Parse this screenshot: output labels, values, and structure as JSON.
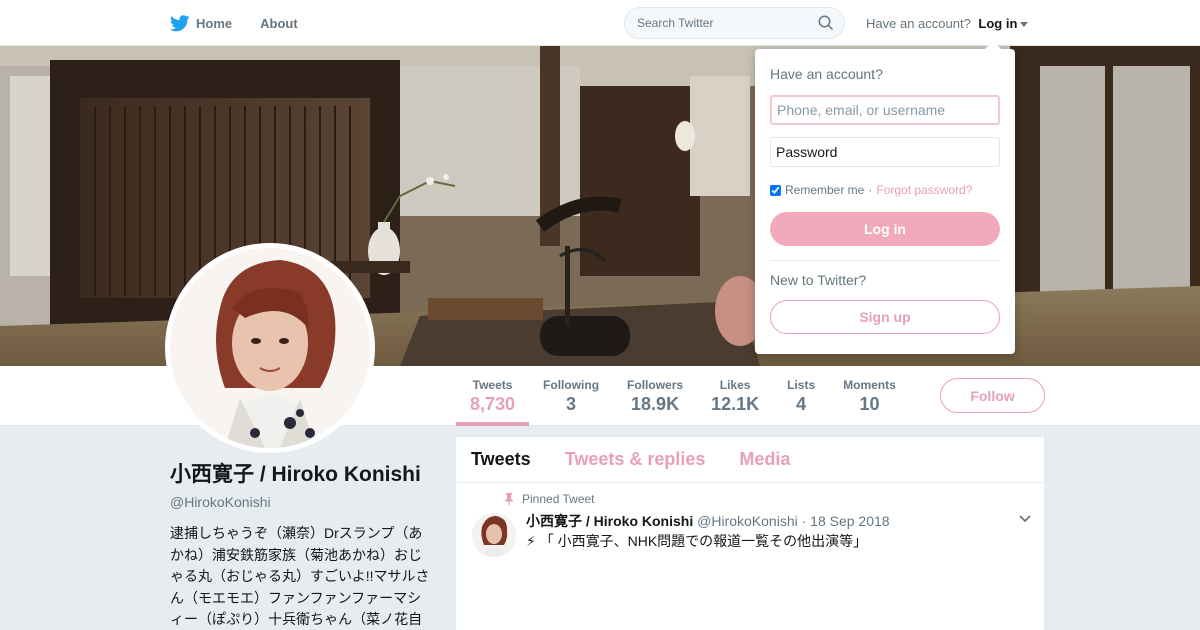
{
  "nav": {
    "home_label": "Home",
    "about_label": "About",
    "search_placeholder": "Search Twitter",
    "have_account_text": "Have an account?",
    "login_label": "Log in",
    "brand_color": "#1da1f2"
  },
  "profile": {
    "name": "小西寛子 / Hiroko Konishi",
    "handle": "@HirokoKonishi",
    "bio": "逮捕しちゃうぞ（瀬奈）Drスランプ（あかね）浦安鉄筋家族（菊池あかね）おじゃる丸（おじゃる丸）すごいよ!!マサルさん（モエモエ）ファンファンファーマシィー（ぽぷり）十兵衛ちゃん（菜ノ花自由）デジモンアドベンチャー（タケル）",
    "accent_color": "#e8a0b4"
  },
  "stats": [
    {
      "label": "Tweets",
      "value": "8,730",
      "active": true
    },
    {
      "label": "Following",
      "value": "3"
    },
    {
      "label": "Followers",
      "value": "18.9K"
    },
    {
      "label": "Likes",
      "value": "12.1K"
    },
    {
      "label": "Lists",
      "value": "4"
    },
    {
      "label": "Moments",
      "value": "10"
    }
  ],
  "follow_label": "Follow",
  "timeline": {
    "tabs": [
      "Tweets",
      "Tweets & replies",
      "Media"
    ],
    "active_tab": "Tweets",
    "pinned_label": "Pinned Tweet",
    "tweet": {
      "name": "小西寛子 / Hiroko Konishi",
      "handle": "@HirokoKonishi",
      "date": "· 18 Sep 2018",
      "text": "⚡ 「 小西寛子、NHK問題での報道一覧その他出演等」"
    }
  },
  "login_dropdown": {
    "title": "Have an account?",
    "username_placeholder": "Phone, email, or username",
    "password_placeholder": "Password",
    "remember_label": "Remember me",
    "separator": "·",
    "forgot_label": "Forgot password?",
    "login_button": "Log in",
    "new_text": "New to Twitter?",
    "signup_button": "Sign up"
  }
}
